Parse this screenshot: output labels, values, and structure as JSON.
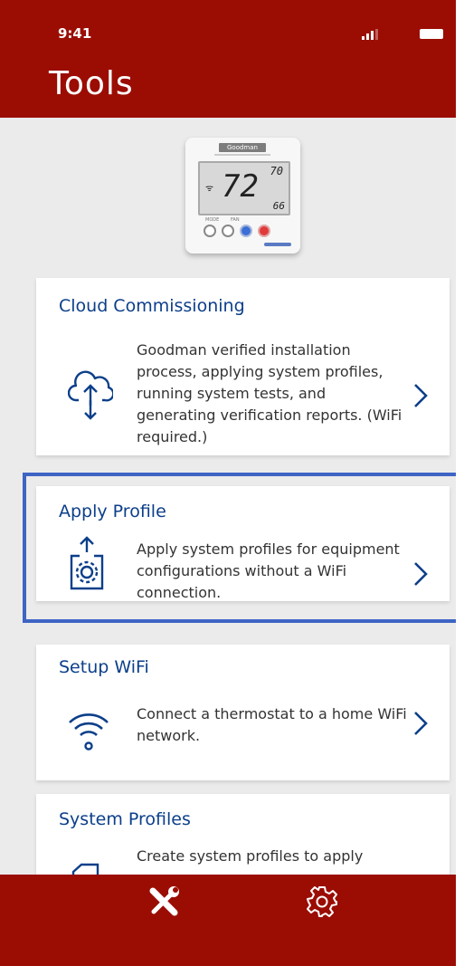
{
  "status_bar": {
    "time": "9:41"
  },
  "header": {
    "title": "Tools"
  },
  "thermostat": {
    "brand": "Goodman",
    "display_temp": "72",
    "set_point_top": "70",
    "set_point_bottom": "66",
    "button_labels": [
      "MODE",
      "FAN"
    ]
  },
  "tools": [
    {
      "title": "Cloud Commissioning",
      "description": "Goodman verified installation process, applying system profiles, running system tests, and generating verification reports. (WiFi required.)",
      "icon": "cloud-sync-icon"
    },
    {
      "title": "Apply Profile",
      "description": "Apply system profiles for equipment configurations without a WiFi connection.",
      "icon": "apply-profile-icon"
    },
    {
      "title": "Setup WiFi",
      "description": "Connect a thermostat to a home WiFi network.",
      "icon": "wifi-icon"
    },
    {
      "title": "System Profiles",
      "description": "Create system profiles to apply",
      "icon": "system-profiles-icon"
    }
  ],
  "tab_bar": {
    "items": [
      {
        "name": "Tools",
        "icon": "tools-icon",
        "selected": true
      },
      {
        "name": "Settings",
        "icon": "gear-icon",
        "selected": false
      }
    ]
  },
  "colors": {
    "brand_red": "#9b0d03",
    "title_blue": "#0c3f8a",
    "highlight_blue": "#3e64c4",
    "background": "#ebebeb"
  }
}
